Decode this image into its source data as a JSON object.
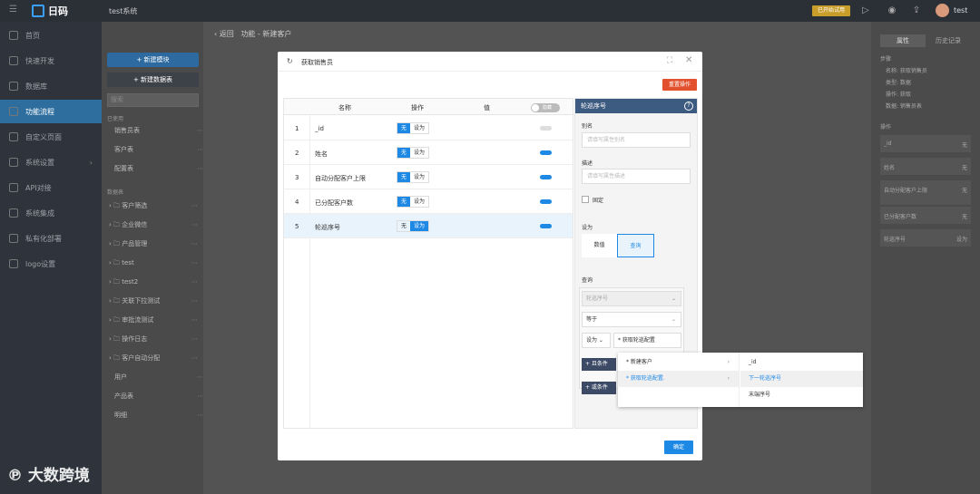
{
  "topbar": {
    "logo_text": "日码",
    "system_name": "test系统",
    "badge": "已开始试用",
    "user": "test"
  },
  "sidebar": {
    "items": [
      {
        "label": "首页"
      },
      {
        "label": "快速开发"
      },
      {
        "label": "数据库"
      },
      {
        "label": "功能流程",
        "active": true
      },
      {
        "label": "自定义页面"
      },
      {
        "label": "系统设置",
        "arrow": true
      },
      {
        "label": "API对接"
      },
      {
        "label": "系统集成"
      },
      {
        "label": "私有化部署"
      },
      {
        "label": "logo设置"
      }
    ]
  },
  "panel2": {
    "new_module": "+ 新建模块",
    "new_table": "+ 新建数据表",
    "search_placeholder": "搜索",
    "used_label": "已使用",
    "used_items": [
      "销售员表",
      "客户表",
      "配置表"
    ],
    "datatable_label": "数据表",
    "tables": [
      "客户筛选",
      "企业微信",
      "产品管理",
      "test",
      "test2",
      "关联下拉测试",
      "审批流测试",
      "操作日志",
      "客户自动分配",
      "用户",
      "产品表",
      "明细"
    ]
  },
  "main": {
    "back": "返回",
    "breadcrumb": "功能 - 新建客户"
  },
  "rightpanel": {
    "tabs": [
      "属性",
      "历史记录"
    ],
    "steps_title": "步骤",
    "steps": [
      "名称: 获取销售员",
      "类型: 数据",
      "操作: 获取",
      "数据: 销售员表"
    ],
    "ops_title": "操作",
    "rows": [
      {
        "name": "_id",
        "value": "无"
      },
      {
        "name": "姓名",
        "value": "无"
      },
      {
        "name": "自动分配客户上限",
        "value": "无"
      },
      {
        "name": "已分配客户数",
        "value": "无"
      },
      {
        "name": "轮巡序号",
        "value": "设为"
      }
    ]
  },
  "modal": {
    "title": "获取销售员",
    "reset_button": "重置操作",
    "confirm_button": "确定",
    "columns": [
      "名称",
      "操作",
      "值"
    ],
    "header_toggle": "隐藏",
    "seg_none": "无",
    "seg_set": "设为",
    "rows": [
      {
        "num": "1",
        "name": "_id",
        "op": "无",
        "toggle": false
      },
      {
        "num": "2",
        "name": "姓名",
        "op": "无",
        "toggle": true
      },
      {
        "num": "3",
        "name": "自动分配客户上限",
        "op": "无",
        "toggle": true
      },
      {
        "num": "4",
        "name": "已分配客户数",
        "op": "无",
        "toggle": true
      },
      {
        "num": "5",
        "name": "轮巡序号",
        "op": "设为",
        "toggle": true
      }
    ],
    "props": {
      "header": "轮巡序号",
      "alias_label": "别名",
      "alias_placeholder": "请填写属性别名",
      "desc_label": "描述",
      "desc_placeholder": "请填写属性描述",
      "fixed_label": "固定",
      "set_label": "设为",
      "set_options": [
        "数值",
        "查询"
      ],
      "query_label": "查询",
      "query_field": "轮巡序号",
      "query_op": "等于",
      "set_small": "设为",
      "query_value": "* 获取轮巡配置",
      "and_btn": "+ 且条件",
      "or_btn": "+ 或条件"
    }
  },
  "dropdown": {
    "col1": [
      {
        "label": "* 新建客户",
        "highlight": false
      },
      {
        "label": "* 获取轮巡配置.",
        "highlight": true
      }
    ],
    "col2": [
      {
        "label": "_id",
        "highlight": false
      },
      {
        "label": "下一轮巡序号",
        "highlight": true
      },
      {
        "label": "末端序号",
        "highlight": false
      }
    ]
  },
  "watermark": "大数跨境"
}
